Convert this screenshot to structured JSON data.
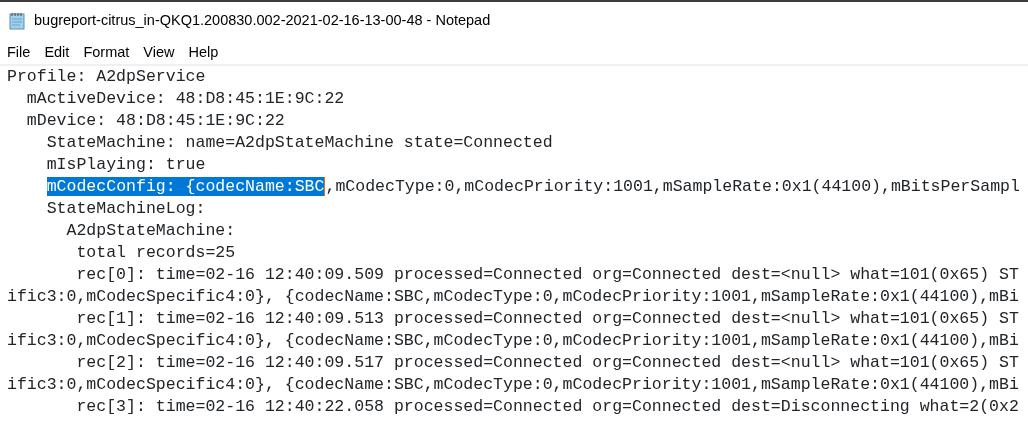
{
  "window": {
    "title": "bugreport-citrus_in-QKQ1.200830.002-2021-02-16-13-00-48 - Notepad"
  },
  "menu": [
    {
      "label": "File"
    },
    {
      "label": "Edit"
    },
    {
      "label": "Format"
    },
    {
      "label": "View"
    },
    {
      "label": "Help"
    }
  ],
  "editor": {
    "lines": [
      {
        "segments": [
          {
            "text": "Profile: A2dpService",
            "selected": false
          }
        ]
      },
      {
        "segments": [
          {
            "text": "  mActiveDevice: 48:D8:45:1E:9C:22",
            "selected": false
          }
        ]
      },
      {
        "segments": [
          {
            "text": "  mDevice: 48:D8:45:1E:9C:22",
            "selected": false
          }
        ]
      },
      {
        "segments": [
          {
            "text": "    StateMachine: name=A2dpStateMachine state=Connected",
            "selected": false
          }
        ]
      },
      {
        "segments": [
          {
            "text": "    mIsPlaying: true",
            "selected": false
          }
        ]
      },
      {
        "segments": [
          {
            "text": "    mCodecConfig: {codecName:SBC",
            "selected": true
          },
          {
            "text": ",mCodecType:0,mCodecPriority:1001,mSampleRate:0x1(44100),mBitsPerSampl",
            "selected": false
          }
        ]
      },
      {
        "segments": [
          {
            "text": "    StateMachineLog:",
            "selected": false
          }
        ]
      },
      {
        "segments": [
          {
            "text": "      A2dpStateMachine:",
            "selected": false
          }
        ]
      },
      {
        "segments": [
          {
            "text": "       total records=25",
            "selected": false
          }
        ]
      },
      {
        "segments": [
          {
            "text": "       rec[0]: time=02-16 12:40:09.509 processed=Connected org=Connected dest=<null> what=101(0x65) ST",
            "selected": false
          }
        ]
      },
      {
        "segments": [
          {
            "text": "ific3:0,mCodecSpecific4:0}, {codecName:SBC,mCodecType:0,mCodecPriority:1001,mSampleRate:0x1(44100),mBi",
            "selected": false
          }
        ]
      },
      {
        "segments": [
          {
            "text": "       rec[1]: time=02-16 12:40:09.513 processed=Connected org=Connected dest=<null> what=101(0x65) ST",
            "selected": false
          }
        ]
      },
      {
        "segments": [
          {
            "text": "ific3:0,mCodecSpecific4:0}, {codecName:SBC,mCodecType:0,mCodecPriority:1001,mSampleRate:0x1(44100),mBi",
            "selected": false
          }
        ]
      },
      {
        "segments": [
          {
            "text": "       rec[2]: time=02-16 12:40:09.517 processed=Connected org=Connected dest=<null> what=101(0x65) ST",
            "selected": false
          }
        ]
      },
      {
        "segments": [
          {
            "text": "ific3:0,mCodecSpecific4:0}, {codecName:SBC,mCodecType:0,mCodecPriority:1001,mSampleRate:0x1(44100),mBi",
            "selected": false
          }
        ]
      },
      {
        "segments": [
          {
            "text": "       rec[3]: time=02-16 12:40:22.058 processed=Connected org=Connected dest=Disconnecting what=2(0x2",
            "selected": false
          }
        ]
      }
    ]
  }
}
